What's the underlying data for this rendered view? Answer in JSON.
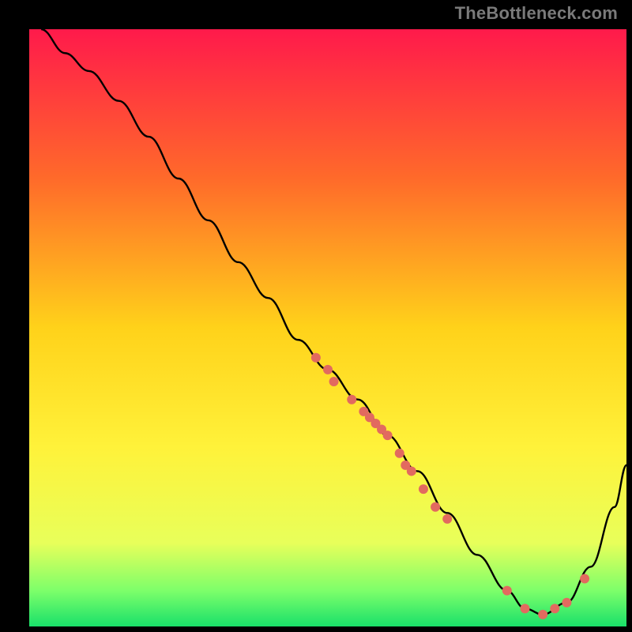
{
  "watermark": "TheBottleneck.com",
  "chart_data": {
    "type": "line",
    "title": "",
    "xlabel": "",
    "ylabel": "",
    "xlim": [
      0,
      100
    ],
    "ylim": [
      0,
      100
    ],
    "background_gradient": {
      "stops": [
        {
          "offset": 0.0,
          "color": "#ff1a4b"
        },
        {
          "offset": 0.25,
          "color": "#ff6a2a"
        },
        {
          "offset": 0.5,
          "color": "#ffd21a"
        },
        {
          "offset": 0.7,
          "color": "#fff23a"
        },
        {
          "offset": 0.86,
          "color": "#e8ff5a"
        },
        {
          "offset": 0.94,
          "color": "#7dff6a"
        },
        {
          "offset": 1.0,
          "color": "#19e06a"
        }
      ]
    },
    "series": [
      {
        "name": "bottleneck-curve",
        "type": "line",
        "x": [
          2,
          6,
          10,
          15,
          20,
          25,
          30,
          35,
          40,
          45,
          50,
          55,
          60,
          65,
          70,
          75,
          80,
          83,
          86,
          90,
          94,
          98,
          100
        ],
        "y": [
          100,
          96,
          93,
          88,
          82,
          75,
          68,
          61,
          55,
          48,
          43,
          38,
          32,
          26,
          19,
          12,
          6,
          3,
          2,
          4,
          10,
          20,
          27
        ],
        "color": "#000000",
        "linewidth": 2
      },
      {
        "name": "curve-markers",
        "type": "scatter",
        "x": [
          48,
          50,
          51,
          54,
          56,
          57,
          58,
          59,
          60,
          62,
          63,
          64,
          66,
          68,
          70,
          80,
          83,
          86,
          88,
          90,
          93
        ],
        "y": [
          45,
          43,
          41,
          38,
          36,
          35,
          34,
          33,
          32,
          29,
          27,
          26,
          23,
          20,
          18,
          6,
          3,
          2,
          3,
          4,
          8
        ],
        "color": "#e26a5f",
        "marker_size": 6
      }
    ]
  }
}
